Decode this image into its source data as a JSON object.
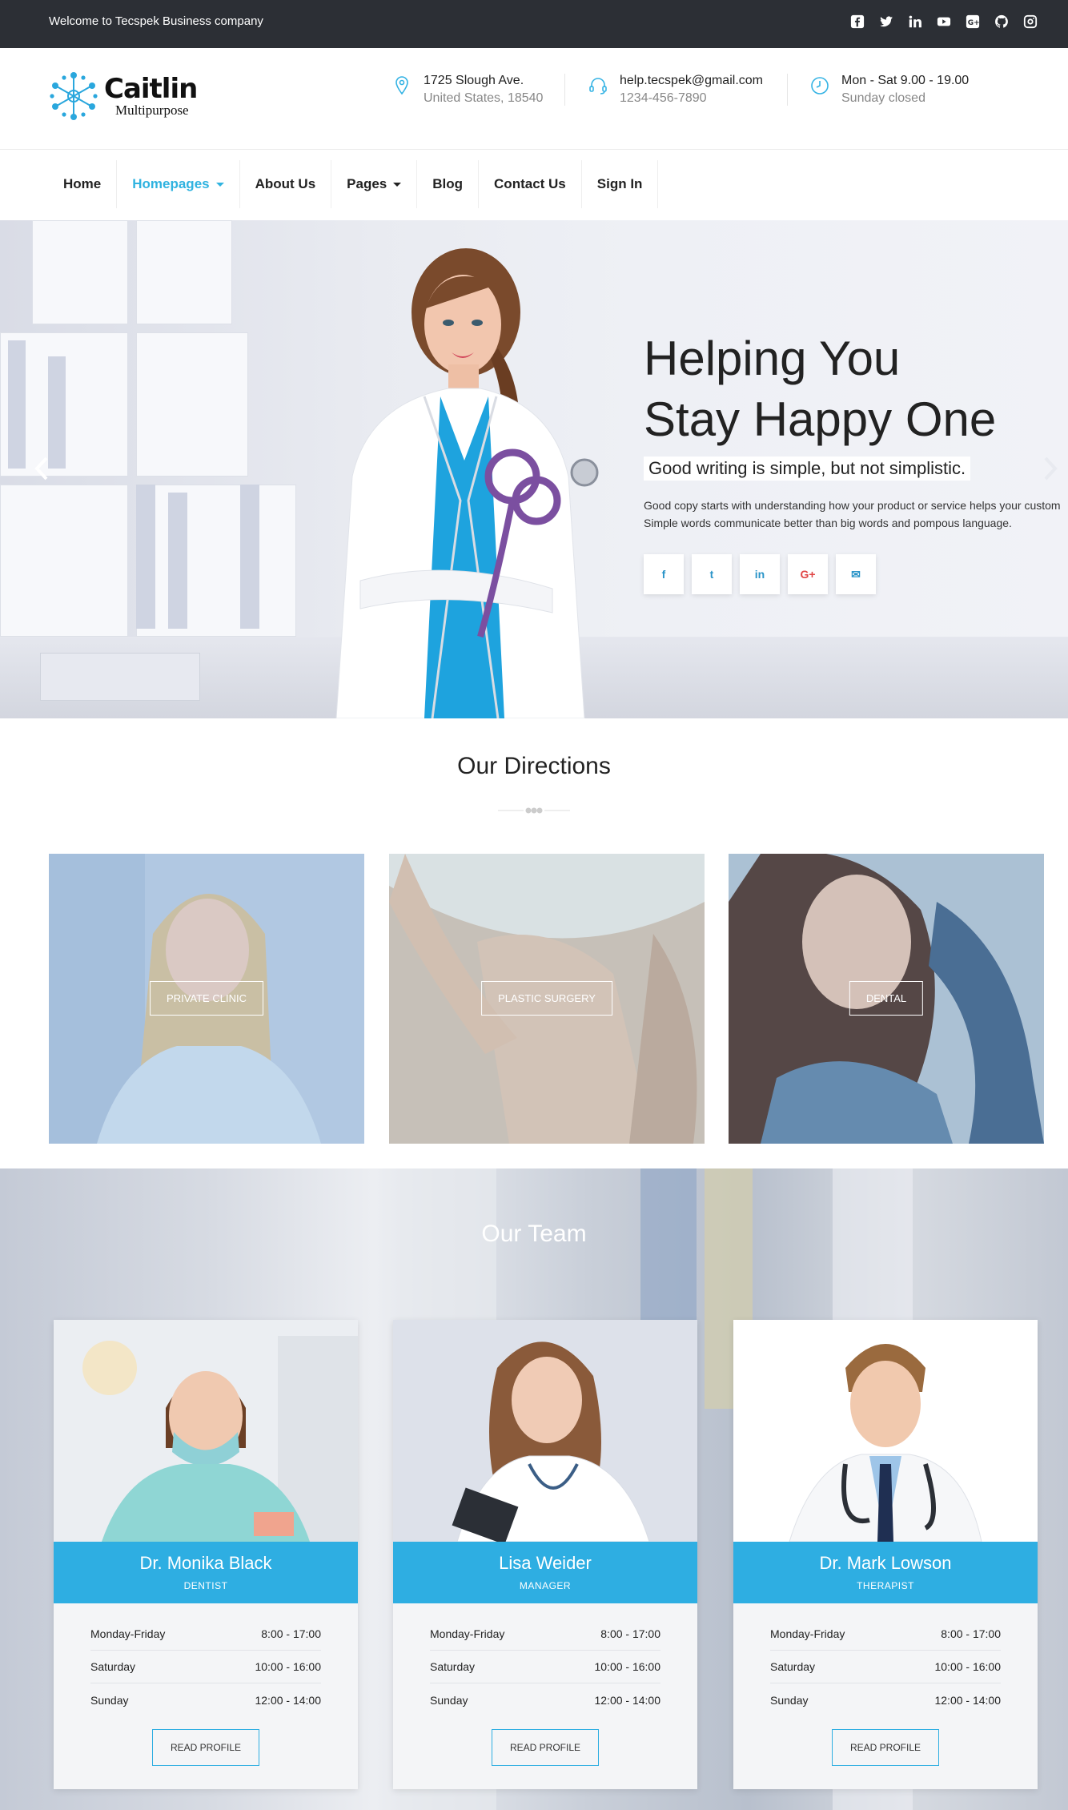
{
  "topbar": {
    "welcome": "Welcome to Tecspek Business company",
    "socials": [
      "facebook-icon",
      "twitter-icon",
      "linkedin-icon",
      "youtube-icon",
      "google-plus-icon",
      "github-icon",
      "instagram-icon"
    ]
  },
  "logo": {
    "name": "Caitlin",
    "tagline": "Multipurpose"
  },
  "contact": {
    "address": {
      "line1": "1725 Slough Ave.",
      "line2": "United States, 18540"
    },
    "email": {
      "line1": "help.tecspek@gmail.com",
      "line2": "1234-456-7890"
    },
    "hours": {
      "line1": "Mon - Sat 9.00 - 19.00",
      "line2": "Sunday closed"
    }
  },
  "nav": {
    "items": [
      {
        "label": "Home"
      },
      {
        "label": "Homepages"
      },
      {
        "label": "About Us"
      },
      {
        "label": "Pages"
      },
      {
        "label": "Blog"
      },
      {
        "label": "Contact Us"
      },
      {
        "label": "Sign In"
      }
    ]
  },
  "hero": {
    "title_line1": "Helping You",
    "title_line2": "Stay Happy One",
    "subtitle": "Good writing is simple, but not simplistic.",
    "desc_line1": "Good copy starts with understanding how your product or service helps your custom",
    "desc_line2": "Simple words communicate better than big words and pompous language.",
    "social": [
      "f",
      "t",
      "in",
      "G+",
      "✉"
    ]
  },
  "directions": {
    "title": "Our Directions",
    "cards": [
      {
        "label": "PRIVATE CLINIC"
      },
      {
        "label": "PLASTIC SURGERY"
      },
      {
        "label": "DENTAL"
      }
    ]
  },
  "team": {
    "title": "Our Team",
    "members": [
      {
        "name": "Dr. Monika Black",
        "role": "DENTIST",
        "hours": [
          [
            "Monday-Friday",
            "8:00 - 17:00"
          ],
          [
            "Saturday",
            "10:00 - 16:00"
          ],
          [
            "Sunday",
            "12:00 - 14:00"
          ]
        ],
        "button": "READ PROFILE"
      },
      {
        "name": "Lisa Weider",
        "role": "MANAGER",
        "hours": [
          [
            "Monday-Friday",
            "8:00 - 17:00"
          ],
          [
            "Saturday",
            "10:00 - 16:00"
          ],
          [
            "Sunday",
            "12:00 - 14:00"
          ]
        ],
        "button": "READ PROFILE"
      },
      {
        "name": "Dr. Mark Lowson",
        "role": "THERAPIST",
        "hours": [
          [
            "Monday-Friday",
            "8:00 - 17:00"
          ],
          [
            "Saturday",
            "10:00 - 16:00"
          ],
          [
            "Sunday",
            "12:00 - 14:00"
          ]
        ],
        "button": "READ PROFILE"
      }
    ]
  },
  "colors": {
    "accent": "#2eaee2",
    "topbar": "#2c2f35"
  }
}
